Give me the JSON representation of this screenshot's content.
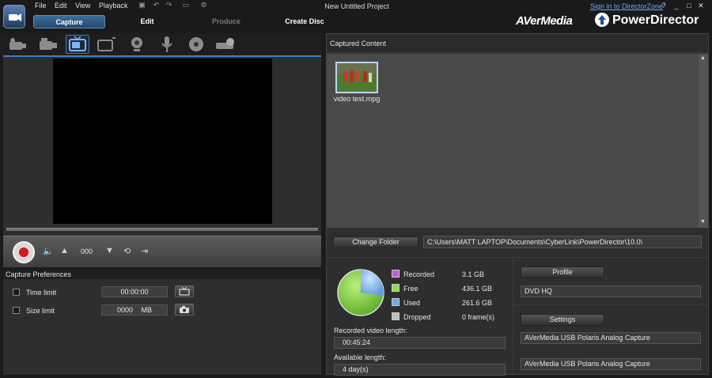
{
  "menu": [
    "File",
    "Edit",
    "View",
    "Playback"
  ],
  "project_title": "New Untitled Project",
  "signin_link": "Sign in to DirectorZone",
  "window_controls": {
    "help": "?",
    "minimize": "_",
    "maximize": "□",
    "close": "✕"
  },
  "nav_tabs": [
    "Capture",
    "Edit",
    "Produce",
    "Create Disc"
  ],
  "brand": {
    "vendor": "AVerMedia",
    "product": "PowerDirector"
  },
  "sources": [
    "dv-camcorder-icon",
    "hdv-camcorder-icon",
    "tv-icon",
    "digital-tv-icon",
    "webcam-icon",
    "microphone-icon",
    "cd-icon",
    "optical-drive-icon"
  ],
  "controls": {
    "counter": "000"
  },
  "capture_prefs": {
    "heading": "Capture Preferences",
    "time_limit_label": "Time limit",
    "time_limit_value": "00:00:00",
    "size_limit_label": "Size limit",
    "size_limit_value": "0000",
    "size_unit": "MB"
  },
  "captured_content": {
    "heading": "Captured Content",
    "items": [
      {
        "name": "video test.mpg"
      }
    ]
  },
  "folder": {
    "button": "Change Folder",
    "path": "C:\\Users\\MATT LAPTOP\\Documents\\CyberLink\\PowerDirector\\10.0\\"
  },
  "disk": {
    "legend": [
      {
        "label": "Recorded",
        "value": "3.1  GB",
        "color": "#c35bd6"
      },
      {
        "label": "Free",
        "value": "436.1  GB",
        "color": "#8fdc4a"
      },
      {
        "label": "Used",
        "value": "261.6  GB",
        "color": "#6ea9e6"
      },
      {
        "label": "Dropped",
        "value": "0 frame(s)",
        "color": "#bdbdbd"
      }
    ],
    "recorded_length_label": "Recorded video length:",
    "recorded_length": "00:45:24",
    "available_length_label": "Available length:",
    "available_length": "4 day(s)"
  },
  "profile": {
    "button": "Profile",
    "value": "DVD HQ"
  },
  "settings": {
    "button": "Settings",
    "device_video": "AVerMedia USB Polaris Analog Capture",
    "device_audio": "AVerMedia USB Polaris Analog Capture"
  },
  "colors": {
    "accent": "#3f7fc0",
    "record": "#d11919"
  }
}
